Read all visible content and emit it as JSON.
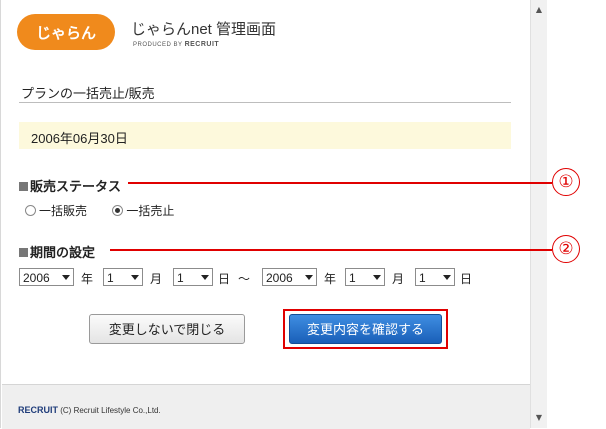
{
  "header": {
    "logo_text": "じゃらん",
    "app_title": "じゃらんnet 管理画面",
    "produced_by": "PRODUCED BY",
    "produced_brand": "RECRUIT"
  },
  "section_title": "プランの一括売止/販売",
  "date_display": "2006年06月30日",
  "status": {
    "label": "販売ステータス",
    "options": [
      {
        "label": "一括販売",
        "selected": false
      },
      {
        "label": "一括売止",
        "selected": true
      }
    ]
  },
  "period": {
    "label": "期間の設定",
    "start": {
      "year": "2006",
      "month": "1",
      "day": "1"
    },
    "end": {
      "year": "2006",
      "month": "1",
      "day": "1"
    },
    "unit_year": "年",
    "unit_month": "月",
    "unit_day": "日",
    "separator": "～"
  },
  "annotations": [
    "①",
    "②"
  ],
  "buttons": {
    "close": "変更しないで閉じる",
    "confirm": "変更内容を確認する"
  },
  "footer": {
    "brand": "RECRUIT",
    "copyright": "(C) Recruit Lifestyle Co.,Ltd."
  },
  "colors": {
    "accent": "#f08a1c",
    "annotation": "#e00000",
    "confirm_button": "#2a74cc",
    "date_bg": "#fdf9dc"
  }
}
